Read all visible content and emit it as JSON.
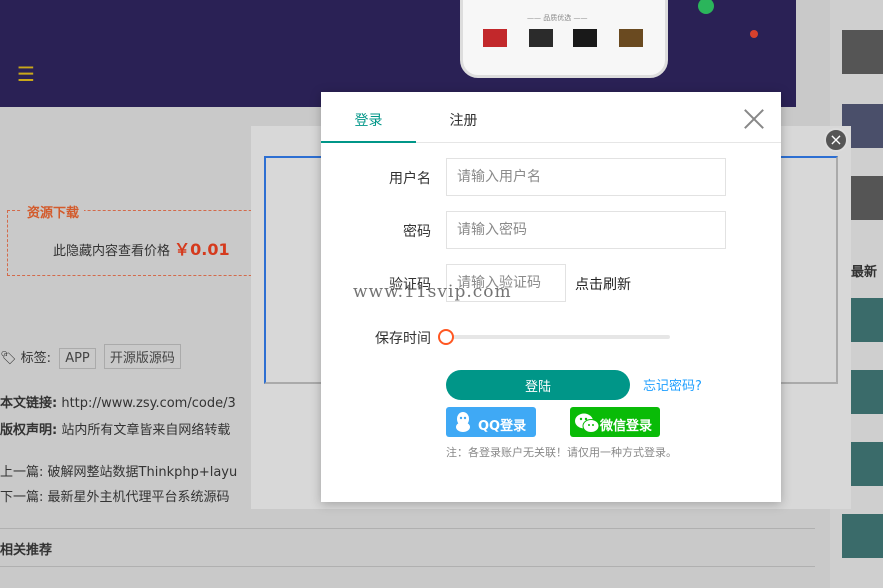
{
  "background": {
    "phone_title": "—— 品质优选 ——",
    "resource_title": "资源下载",
    "price_label": "此隐藏内容查看价格",
    "price": "￥0.01",
    "tags_label": "标签:",
    "tags": [
      "APP",
      "开源版源码"
    ],
    "link_label": "本文链接:",
    "link_value": "http://www.zsy.com/code/3",
    "copyright_label": "版权声明:",
    "copyright_value": "站内所有文章皆来自网络转载",
    "prev_label": "上一篇:",
    "prev_value": "破解网整站数据Thinkphp+layu",
    "next_label": "下一篇:",
    "next_value": "最新星外主机代理平台系统源码",
    "related_title": "相关推荐",
    "sidebar_heading": "最新"
  },
  "login_modal": {
    "tabs": [
      {
        "label": "登录",
        "active": true
      },
      {
        "label": "注册",
        "active": false
      }
    ],
    "username": {
      "label": "用户名",
      "placeholder": "请输入用户名"
    },
    "password": {
      "label": "密码",
      "placeholder": "请输入密码"
    },
    "captcha": {
      "label": "验证码",
      "placeholder": "请输入验证码",
      "refresh": "点击刷新"
    },
    "remember": {
      "label": "保存时间",
      "value": 0
    },
    "login_button": "登陆",
    "forgot_link": "忘记密码?",
    "qq_login": "QQ登录",
    "wechat_login": "微信登录",
    "note": "注：各登录账户无关联！请仅用一种方式登录。"
  },
  "watermark": "www.11svip.com",
  "colors": {
    "accent": "#009688",
    "link": "#1e9fff",
    "slider": "#ff5722",
    "qq": "#3fa9f5",
    "wechat": "#09bb07",
    "banner": "#2a2155"
  }
}
